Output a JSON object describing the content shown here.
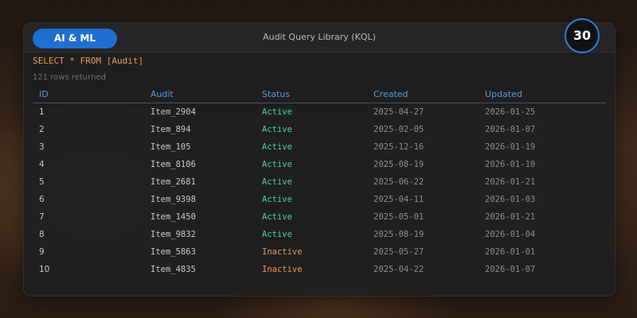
{
  "header": {
    "pill_label": "AI & ML",
    "title": "Audit Query Library (KQL)"
  },
  "badge": "30",
  "query": "SELECT * FROM [Audit]",
  "result_summary": "121 rows returned",
  "colors": {
    "accent": "#1f6fd0",
    "column_header": "#5b9bd8",
    "status_active": "#4fd1a5",
    "status_inactive": "#e39a5e",
    "query_text": "#e39a5e"
  },
  "table": {
    "columns": [
      "ID",
      "Audit",
      "Status",
      "Created",
      "Updated"
    ],
    "rows": [
      {
        "id": "1",
        "audit": "Item_2904",
        "status": "Active",
        "created": "2025-04-27",
        "updated": "2026-01-25"
      },
      {
        "id": "2",
        "audit": "Item_894",
        "status": "Active",
        "created": "2025-02-05",
        "updated": "2026-01-07"
      },
      {
        "id": "3",
        "audit": "Item_105",
        "status": "Active",
        "created": "2025-12-16",
        "updated": "2026-01-19"
      },
      {
        "id": "4",
        "audit": "Item_8106",
        "status": "Active",
        "created": "2025-08-19",
        "updated": "2026-01-10"
      },
      {
        "id": "5",
        "audit": "Item_2681",
        "status": "Active",
        "created": "2025-06-22",
        "updated": "2026-01-21"
      },
      {
        "id": "6",
        "audit": "Item_9398",
        "status": "Active",
        "created": "2025-04-11",
        "updated": "2026-01-03"
      },
      {
        "id": "7",
        "audit": "Item_1450",
        "status": "Active",
        "created": "2025-05-01",
        "updated": "2026-01-21"
      },
      {
        "id": "8",
        "audit": "Item_9832",
        "status": "Active",
        "created": "2025-08-19",
        "updated": "2026-01-04"
      },
      {
        "id": "9",
        "audit": "Item_5863",
        "status": "Inactive",
        "created": "2025-05-27",
        "updated": "2026-01-01"
      },
      {
        "id": "10",
        "audit": "Item_4835",
        "status": "Inactive",
        "created": "2025-04-22",
        "updated": "2026-01-07"
      }
    ]
  }
}
